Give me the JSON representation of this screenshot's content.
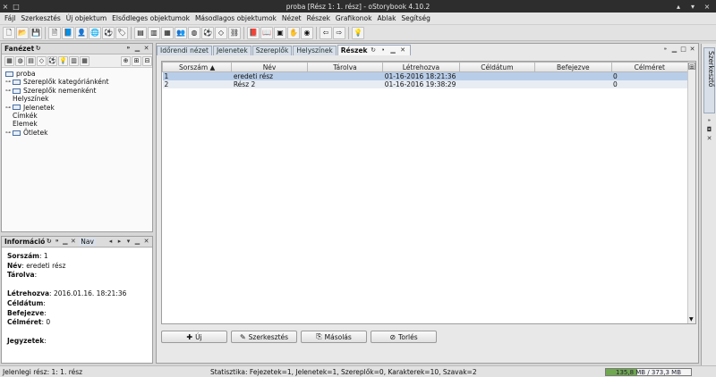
{
  "window": {
    "title": "proba [Rész 1: 1. rész] - oStorybook 4.10.2",
    "controls": [
      "×",
      "□"
    ],
    "right_controls": [
      "▴",
      "▾",
      "×"
    ]
  },
  "menu": [
    "Fájl",
    "Szerkesztés",
    "Új objektum",
    "Elsődleges objektumok",
    "Másodlagos objektumok",
    "Nézet",
    "Részek",
    "Grafikonok",
    "Ablak",
    "Segítség"
  ],
  "toolbar": {
    "groups": [
      [
        "new-file-icon",
        "open-folder-icon",
        "save-icon"
      ],
      [
        "document-icon",
        "book-icon",
        "person-icon",
        "globe-icon",
        "soccer-icon",
        "tag-icon"
      ],
      [
        "chapters-view-icon",
        "scenes-view-icon",
        "table-view-icon",
        "persons-view-icon",
        "globe-view-icon",
        "soccer-view-icon",
        "tag-view-icon",
        "chain-icon"
      ],
      [
        "book-view-icon",
        "reading-icon",
        "manage-icon",
        "hand-icon",
        "memo-icon"
      ],
      [
        "back-arrow-icon",
        "forward-arrow-icon"
      ],
      [
        "idea-icon"
      ]
    ],
    "glyphs": {
      "new-file-icon": "🗋",
      "open-folder-icon": "📂",
      "save-icon": "💾",
      "document-icon": "🗎",
      "book-icon": "📘",
      "person-icon": "👤",
      "globe-icon": "🌐",
      "soccer-icon": "⚽",
      "tag-icon": "🏷",
      "chapters-view-icon": "▤",
      "scenes-view-icon": "▥",
      "table-view-icon": "▦",
      "persons-view-icon": "👥",
      "globe-view-icon": "◍",
      "soccer-view-icon": "⚽",
      "tag-view-icon": "◇",
      "chain-icon": "⛓",
      "book-view-icon": "📕",
      "reading-icon": "📖",
      "manage-icon": "▣",
      "hand-icon": "✋",
      "memo-icon": "◉",
      "back-arrow-icon": "⇦",
      "forward-arrow-icon": "⇨",
      "idea-icon": "💡"
    }
  },
  "tree_panel": {
    "title": "Fanézet",
    "tools": [
      "▦",
      "◍",
      "▤",
      "◇",
      "⚽",
      "💡",
      "▥",
      "▦"
    ],
    "root": "proba",
    "items": [
      {
        "label": "Szereplők kategóriánként",
        "folder": true,
        "toggle": "⊶"
      },
      {
        "label": "Szereplők nemenként",
        "folder": true,
        "toggle": "⊶"
      },
      {
        "label": "Helyszínek",
        "folder": false,
        "toggle": ""
      },
      {
        "label": "Jelenetek",
        "folder": true,
        "toggle": "⊶"
      },
      {
        "label": "Címkék",
        "folder": false,
        "toggle": ""
      },
      {
        "label": "Elemek",
        "folder": false,
        "toggle": ""
      },
      {
        "label": "Ötletek",
        "folder": true,
        "toggle": "⊶"
      }
    ]
  },
  "info_panel": {
    "title": "Információ",
    "tab2": "Nav",
    "fields": [
      {
        "label": "Sorszám",
        "value": "1"
      },
      {
        "label": "Név",
        "value": "eredeti rész"
      },
      {
        "label": "Tárolva",
        "value": ""
      },
      {
        "label": "",
        "value": ""
      },
      {
        "label": "Létrehozva",
        "value": "2016.01.16. 18:21:36"
      },
      {
        "label": "Céldátum",
        "value": ""
      },
      {
        "label": "Befejezve",
        "value": ""
      },
      {
        "label": "Célméret",
        "value": "0"
      },
      {
        "label": "",
        "value": ""
      },
      {
        "label": "Jegyzetek",
        "value": ""
      }
    ]
  },
  "tabs": [
    {
      "label": "Időrendi nézet",
      "active": false
    },
    {
      "label": "Jelenetek",
      "active": false
    },
    {
      "label": "Szereplők",
      "active": false
    },
    {
      "label": "Helyszínek",
      "active": false
    },
    {
      "label": "Részek",
      "active": true
    }
  ],
  "table": {
    "columns": [
      "Sorszám ▲",
      "Név",
      "Tárolva",
      "Létrehozva",
      "Céldátum",
      "Befejezve",
      "Célméret"
    ],
    "rows": [
      [
        "1",
        "eredeti rész",
        "",
        "01-16-2016 18:21:36",
        "",
        "",
        "0"
      ],
      [
        "2",
        "Rész 2",
        "",
        "01-16-2016 19:38:29",
        "",
        "",
        "0"
      ]
    ]
  },
  "actions": [
    {
      "name": "new-button",
      "icon": "✚",
      "label": "Új"
    },
    {
      "name": "edit-button",
      "icon": "✎",
      "label": "Szerkesztés"
    },
    {
      "name": "copy-button",
      "icon": "⎘",
      "label": "Másolás"
    },
    {
      "name": "delete-button",
      "icon": "⊘",
      "label": "Torlés"
    }
  ],
  "status": {
    "current_part": "Jelenlegi rész: 1: 1. rész",
    "stats": "Statisztika: Fejezetek=1,  Jelenetek=1,  Szereplők=0,  Karakterek=10,  Szavak=2",
    "memory_text": "135,8 MB / 373,3 MB",
    "memory_fraction": 0.364
  },
  "right_sidebar": {
    "label": "Szerkesztő"
  }
}
